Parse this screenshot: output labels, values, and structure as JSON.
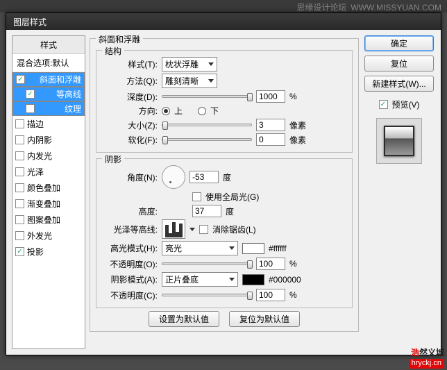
{
  "banner": {
    "text": "思缘设计论坛",
    "url": "WWW.MISSYUAN.COM"
  },
  "dialog": {
    "title": "图层样式"
  },
  "styles": {
    "header": "样式",
    "blendDefault": "混合选项:默认",
    "items": [
      {
        "label": "斜面和浮雕",
        "checked": true
      },
      {
        "label": "等高线",
        "checked": true
      },
      {
        "label": "纹理",
        "checked": false
      },
      {
        "label": "描边",
        "checked": false
      },
      {
        "label": "内阴影",
        "checked": false
      },
      {
        "label": "内发光",
        "checked": false
      },
      {
        "label": "光泽",
        "checked": false
      },
      {
        "label": "颜色叠加",
        "checked": false
      },
      {
        "label": "渐变叠加",
        "checked": false
      },
      {
        "label": "图案叠加",
        "checked": false
      },
      {
        "label": "外发光",
        "checked": false
      },
      {
        "label": "投影",
        "checked": true
      }
    ]
  },
  "panel": {
    "title": "斜面和浮雕",
    "structure": {
      "legend": "结构",
      "styleLabel": "样式(T):",
      "styleValue": "枕状浮雕",
      "techLabel": "方法(Q):",
      "techValue": "雕刻清晰",
      "depthLabel": "深度(D):",
      "depthValue": "1000",
      "depthUnit": "%",
      "dirLabel": "方向:",
      "up": "上",
      "down": "下",
      "sizeLabel": "大小(Z):",
      "sizeValue": "3",
      "sizeUnit": "像素",
      "softLabel": "软化(F):",
      "softValue": "0",
      "softUnit": "像素"
    },
    "shadow": {
      "legend": "阴影",
      "angleLabel": "角度(N):",
      "angleValue": "-53",
      "angleUnit": "度",
      "globalLabel": "使用全局光(G)",
      "altLabel": "高度:",
      "altValue": "37",
      "altUnit": "度",
      "contourLabel": "光泽等高线:",
      "antiLabel": "消除锯齿(L)",
      "hiLabel": "高光模式(H):",
      "hiValue": "亮光",
      "hiColor": "#ffffff",
      "hiOpLabel": "不透明度(O):",
      "hiOpValue": "100",
      "hiOpUnit": "%",
      "shLabel": "阴影模式(A):",
      "shValue": "正片叠底",
      "shColor": "#000000",
      "shOpLabel": "不透明度(C):",
      "shOpValue": "100",
      "shOpUnit": "%"
    },
    "setDefault": "设置为默认值",
    "resetDefault": "复位为默认值"
  },
  "buttons": {
    "ok": "确定",
    "cancel": "复位",
    "newStyle": "新建样式(W)...",
    "preview": "预览(V)"
  },
  "watermark": {
    "cn1": "浩",
    "cn2": "然义城",
    "url": "hryckj.cn"
  }
}
